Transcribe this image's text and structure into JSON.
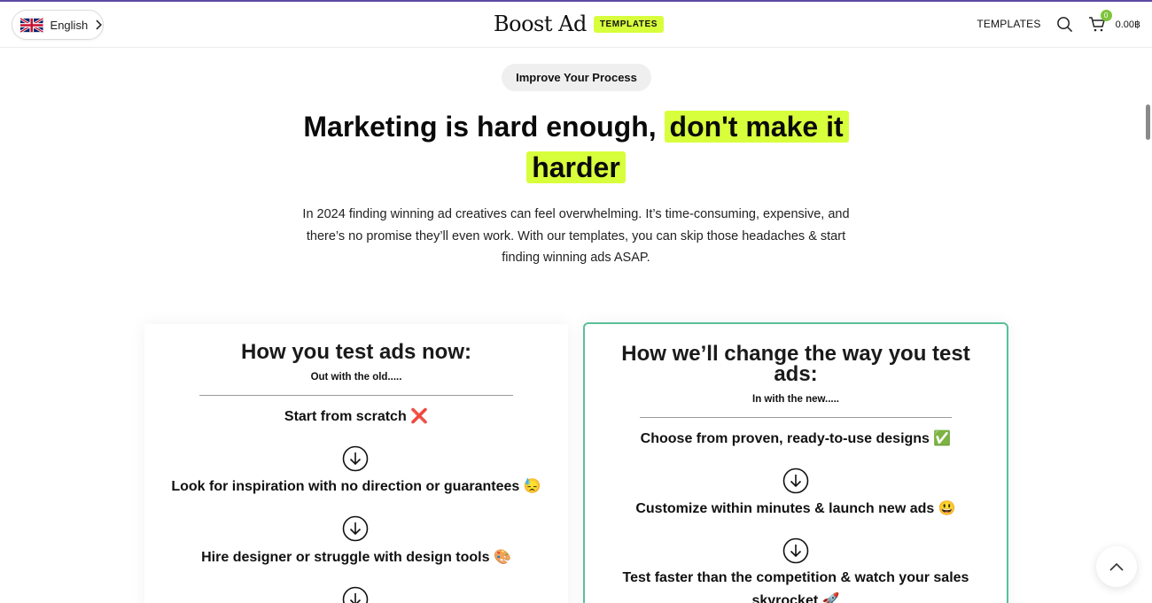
{
  "header": {
    "language_label": "English",
    "logo_text": "Boost Ad",
    "logo_badge": "TEMPLATES",
    "nav_templates": "TEMPLATES",
    "cart_count": "0",
    "cart_total": "0.00฿"
  },
  "hero": {
    "pill": "Improve Your Process",
    "headline_plain": "Marketing is hard enough,",
    "headline_hl1": "don't make it",
    "headline_hl2": "harder",
    "lead": "In 2024 finding winning ad creatives can feel overwhelming. It’s time-consuming, expensive, and there’s no promise they’ll even work. With our templates, you can skip those headaches & start finding winning ads ASAP."
  },
  "old_way": {
    "title": "How you test ads now:",
    "subtitle": "Out with the old.....",
    "steps": [
      "Start from scratch ❌",
      "Look for inspiration with no direction or guarantees 😓",
      "Hire designer or struggle with design tools 🎨"
    ]
  },
  "new_way": {
    "title_line1": "How we’ll change the way you test",
    "title_line2": "ads:",
    "subtitle": "In with the new.....",
    "steps": [
      "Choose from proven, ready-to-use designs ✅",
      "Customize within minutes & launch new ads 😃",
      "Test faster than the competition & watch your sales",
      "skyrocket 🚀"
    ]
  },
  "icons": {
    "flag": "uk-flag-icon",
    "search": "search-icon",
    "cart": "cart-icon",
    "arrow": "arrow-down-circle-icon",
    "back_to_top": "chevron-up-icon"
  },
  "colors": {
    "accent": "#d8ff3c",
    "card_border": "#5bbf98",
    "cart_badge": "#7fc43b",
    "top_bar": "#5b4aa3"
  }
}
